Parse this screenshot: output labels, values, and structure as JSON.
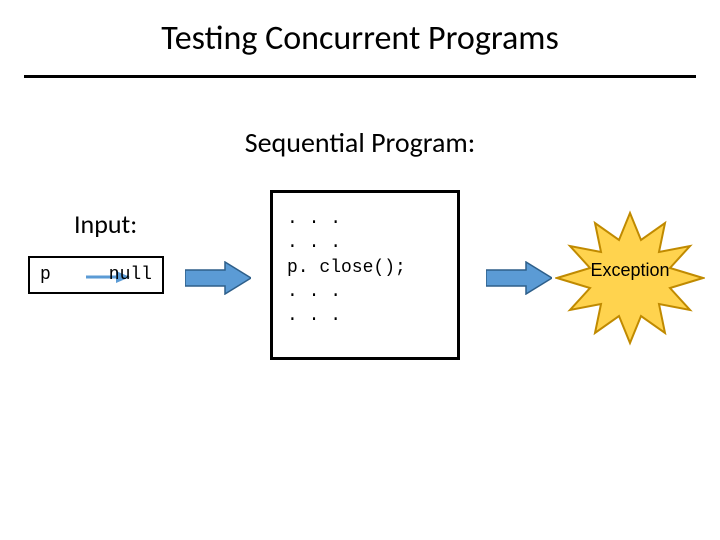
{
  "title": "Testing Concurrent Programs",
  "subhead": "Sequential Program:",
  "input": {
    "label": "Input:",
    "var": "p",
    "value": "null"
  },
  "code": {
    "lines": [
      ". . .",
      ". . .",
      "p. close();",
      ". . .",
      ". . ."
    ]
  },
  "result": {
    "label": "Exception"
  },
  "colors": {
    "arrow_fill": "#5b9bd5",
    "arrow_stroke": "#2e5f8a",
    "burst_fill": "#ffd34e",
    "burst_stroke": "#c08a00"
  }
}
